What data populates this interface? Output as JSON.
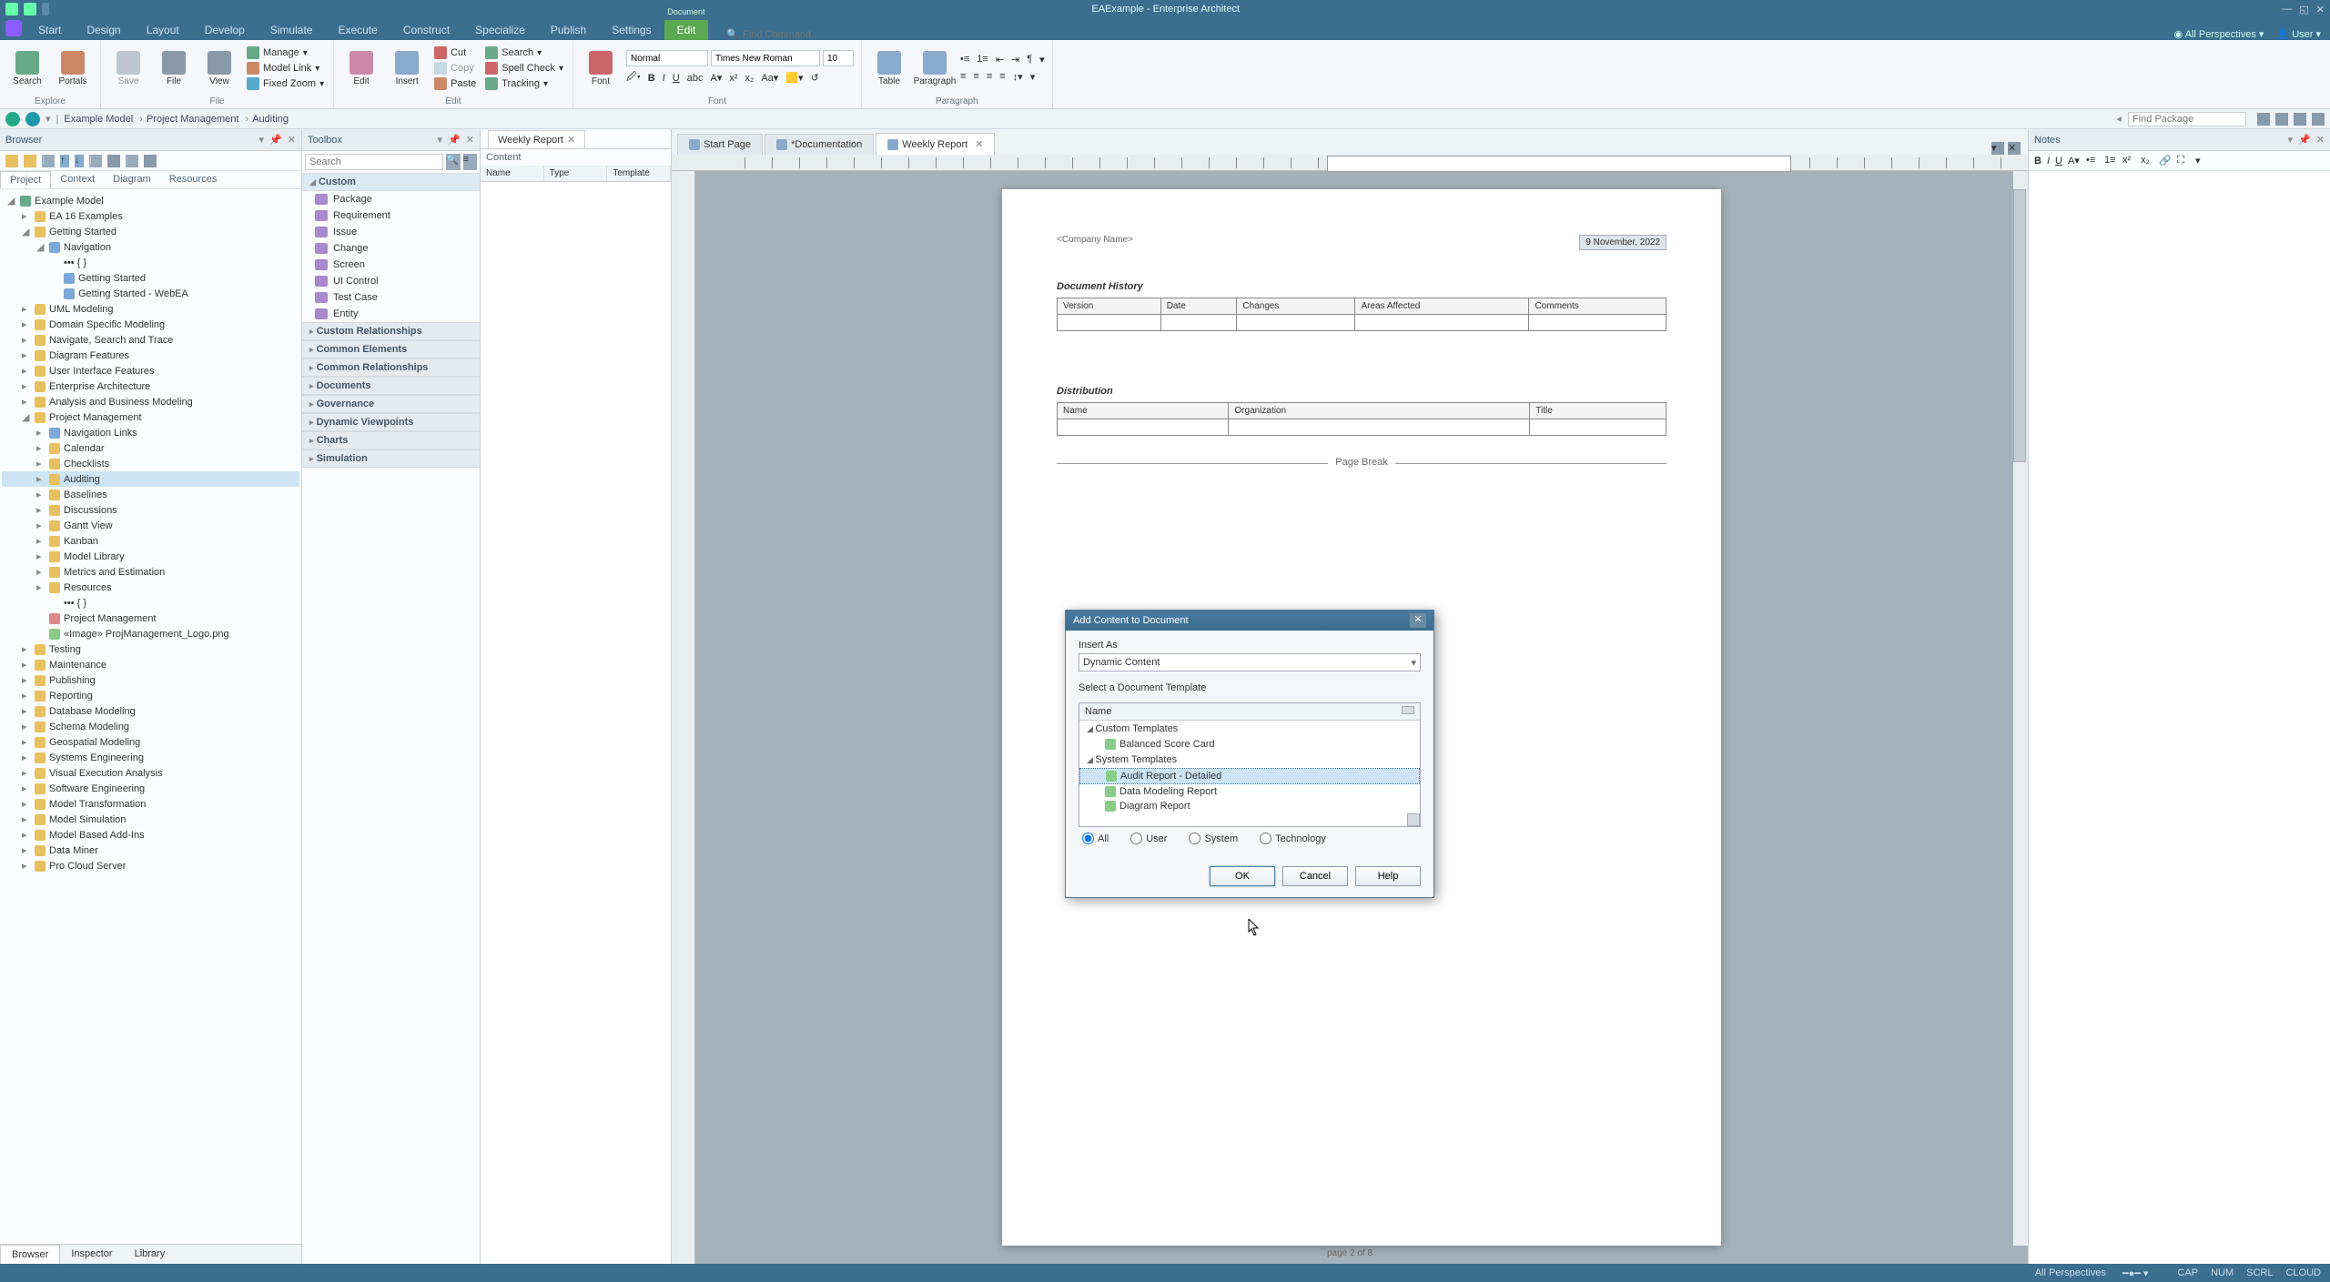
{
  "app": {
    "title": "EAExample - Enterprise Architect"
  },
  "ribbon_tabs": [
    "Start",
    "Design",
    "Layout",
    "Develop",
    "Simulate",
    "Execute",
    "Construct",
    "Specialize",
    "Publish",
    "Settings",
    "Edit"
  ],
  "ribbon_context_tab": "Document",
  "find_command_placeholder": "Find Command...",
  "perspectives_label": "All Perspectives",
  "user_label": "User",
  "ribbon": {
    "explore": {
      "search": "Search",
      "portals": "Portals",
      "label": "Explore"
    },
    "file": {
      "save": "Save",
      "file": "File",
      "view": "View",
      "manage": "Manage",
      "model_link": "Model Link",
      "fixed_zoom": "Fixed Zoom",
      "label": "File"
    },
    "edit": {
      "edit": "Edit",
      "insert": "Insert",
      "cut": "Cut",
      "copy": "Copy",
      "paste": "Paste",
      "search": "Search",
      "spell": "Spell Check",
      "tracking": "Tracking",
      "label": "Edit"
    },
    "font": {
      "style_normal": "Normal",
      "font_name": "Times New Roman",
      "font_size": "10",
      "font": "Font",
      "label": "Font"
    },
    "paragraph": {
      "table": "Table",
      "paragraph": "Paragraph",
      "label": "Paragraph"
    }
  },
  "breadcrumb": [
    "Example Model",
    "Project Management",
    "Auditing"
  ],
  "find_package_placeholder": "Find Package",
  "browser": {
    "title": "Browser",
    "sub_tabs": [
      "Project",
      "Context",
      "Diagram",
      "Resources"
    ],
    "root": "Example Model",
    "tree": [
      {
        "lvl": 1,
        "txt": "EA 16 Examples",
        "ico": "pkg",
        "tw": "▸"
      },
      {
        "lvl": 1,
        "txt": "Getting Started",
        "ico": "pkg",
        "tw": "◢"
      },
      {
        "lvl": 2,
        "txt": "Navigation",
        "ico": "view",
        "tw": "◢"
      },
      {
        "lvl": 3,
        "txt": "••• { }",
        "ico": "",
        "tw": ""
      },
      {
        "lvl": 3,
        "txt": "Getting Started",
        "ico": "view",
        "tw": ""
      },
      {
        "lvl": 3,
        "txt": "Getting Started - WebEA",
        "ico": "view",
        "tw": ""
      },
      {
        "lvl": 1,
        "txt": "UML Modeling",
        "ico": "pkg",
        "tw": "▸"
      },
      {
        "lvl": 1,
        "txt": "Domain Specific Modeling",
        "ico": "pkg",
        "tw": "▸"
      },
      {
        "lvl": 1,
        "txt": "Navigate, Search and Trace",
        "ico": "pkg",
        "tw": "▸"
      },
      {
        "lvl": 1,
        "txt": "Diagram Features",
        "ico": "pkg",
        "tw": "▸"
      },
      {
        "lvl": 1,
        "txt": "User Interface Features",
        "ico": "pkg",
        "tw": "▸"
      },
      {
        "lvl": 1,
        "txt": "Enterprise Architecture",
        "ico": "pkg",
        "tw": "▸"
      },
      {
        "lvl": 1,
        "txt": "Analysis and Business Modeling",
        "ico": "pkg",
        "tw": "▸"
      },
      {
        "lvl": 1,
        "txt": "Project Management",
        "ico": "pkg",
        "tw": "◢"
      },
      {
        "lvl": 2,
        "txt": "Navigation Links",
        "ico": "view",
        "tw": "▸"
      },
      {
        "lvl": 2,
        "txt": "Calendar",
        "ico": "pkg",
        "tw": "▸"
      },
      {
        "lvl": 2,
        "txt": "Checklists",
        "ico": "pkg",
        "tw": "▸"
      },
      {
        "lvl": 2,
        "txt": "Auditing",
        "ico": "pkg",
        "tw": "▸",
        "sel": true
      },
      {
        "lvl": 2,
        "txt": "Baselines",
        "ico": "pkg",
        "tw": "▸"
      },
      {
        "lvl": 2,
        "txt": "Discussions",
        "ico": "pkg",
        "tw": "▸"
      },
      {
        "lvl": 2,
        "txt": "Gantt View",
        "ico": "pkg",
        "tw": "▸"
      },
      {
        "lvl": 2,
        "txt": "Kanban",
        "ico": "pkg",
        "tw": "▸"
      },
      {
        "lvl": 2,
        "txt": "Model Library",
        "ico": "pkg",
        "tw": "▸"
      },
      {
        "lvl": 2,
        "txt": "Metrics and Estimation",
        "ico": "pkg",
        "tw": "▸"
      },
      {
        "lvl": 2,
        "txt": "Resources",
        "ico": "pkg",
        "tw": "▸"
      },
      {
        "lvl": 3,
        "txt": "••• { }",
        "ico": "",
        "tw": ""
      },
      {
        "lvl": 2,
        "txt": "Project Management",
        "ico": "doc",
        "tw": ""
      },
      {
        "lvl": 2,
        "txt": "«Image» ProjManagement_Logo.png",
        "ico": "img",
        "tw": ""
      },
      {
        "lvl": 1,
        "txt": "Testing",
        "ico": "pkg",
        "tw": "▸"
      },
      {
        "lvl": 1,
        "txt": "Maintenance",
        "ico": "pkg",
        "tw": "▸"
      },
      {
        "lvl": 1,
        "txt": "Publishing",
        "ico": "pkg",
        "tw": "▸"
      },
      {
        "lvl": 1,
        "txt": "Reporting",
        "ico": "pkg",
        "tw": "▸"
      },
      {
        "lvl": 1,
        "txt": "Database Modeling",
        "ico": "pkg",
        "tw": "▸"
      },
      {
        "lvl": 1,
        "txt": "Schema Modeling",
        "ico": "pkg",
        "tw": "▸"
      },
      {
        "lvl": 1,
        "txt": "Geospatial Modeling",
        "ico": "pkg",
        "tw": "▸"
      },
      {
        "lvl": 1,
        "txt": "Systems Engineering",
        "ico": "pkg",
        "tw": "▸"
      },
      {
        "lvl": 1,
        "txt": "Visual Execution Analysis",
        "ico": "pkg",
        "tw": "▸"
      },
      {
        "lvl": 1,
        "txt": "Software Engineering",
        "ico": "pkg",
        "tw": "▸"
      },
      {
        "lvl": 1,
        "txt": "Model Transformation",
        "ico": "pkg",
        "tw": "▸"
      },
      {
        "lvl": 1,
        "txt": "Model Simulation",
        "ico": "pkg",
        "tw": "▸"
      },
      {
        "lvl": 1,
        "txt": "Model Based Add-Ins",
        "ico": "pkg",
        "tw": "▸"
      },
      {
        "lvl": 1,
        "txt": "Data Miner",
        "ico": "pkg",
        "tw": "▸"
      },
      {
        "lvl": 1,
        "txt": "Pro Cloud Server",
        "ico": "pkg",
        "tw": "▸"
      }
    ],
    "bottom_tabs": [
      "Browser",
      "Inspector",
      "Library"
    ]
  },
  "toolbox": {
    "title": "Toolbox",
    "search_placeholder": "Search",
    "categories": [
      {
        "name": "Custom",
        "open": true,
        "items": [
          "Package",
          "Requirement",
          "Issue",
          "Change",
          "Screen",
          "UI Control",
          "Test Case",
          "Entity"
        ]
      },
      {
        "name": "Custom Relationships",
        "open": false
      },
      {
        "name": "Common Elements",
        "open": false
      },
      {
        "name": "Common Relationships",
        "open": false
      },
      {
        "name": "Documents",
        "open": false
      },
      {
        "name": "Governance",
        "open": false
      },
      {
        "name": "Dynamic Viewpoints",
        "open": false
      },
      {
        "name": "Charts",
        "open": false
      },
      {
        "name": "Simulation",
        "open": false
      }
    ]
  },
  "content_panel": {
    "tab": "Weekly Report",
    "heading": "Content",
    "cols": [
      "Name",
      "Type",
      "Template"
    ]
  },
  "doc_tabs": [
    {
      "label": "Start Page",
      "active": false,
      "icon": "globe"
    },
    {
      "label": "*Documentation",
      "active": false,
      "icon": "diagram"
    },
    {
      "label": "Weekly Report",
      "active": true,
      "icon": "doc"
    }
  ],
  "document": {
    "company": "<Company Name>",
    "date": "9 November, 2022",
    "history_heading": "Document History",
    "history_cols": [
      "Version",
      "Date",
      "Changes",
      "Areas Affected",
      "Comments"
    ],
    "dist_heading": "Distribution",
    "dist_cols": [
      "Name",
      "Organization",
      "Title"
    ],
    "page_break": "Page Break",
    "footer": "page 2 of 8"
  },
  "notes": {
    "title": "Notes"
  },
  "dialog": {
    "title": "Add Content to Document",
    "insert_as_label": "Insert As",
    "insert_as_value": "Dynamic Content",
    "select_template_label": "Select a Document Template",
    "name_col": "Name",
    "groups": [
      {
        "name": "Custom Templates",
        "items": [
          {
            "name": "Balanced Score Card"
          }
        ]
      },
      {
        "name": "System Templates",
        "items": [
          {
            "name": "Audit Report - Detailed",
            "sel": true
          },
          {
            "name": "Data Modeling Report"
          },
          {
            "name": "Diagram Report"
          }
        ]
      }
    ],
    "radios": [
      "All",
      "User",
      "System",
      "Technology"
    ],
    "radio_selected": "All",
    "ok": "OK",
    "cancel": "Cancel",
    "help": "Help"
  },
  "statusbar": {
    "perspectives": "All Perspectives",
    "indicators": [
      "CAP",
      "NUM",
      "SCRL",
      "CLOUD"
    ]
  }
}
